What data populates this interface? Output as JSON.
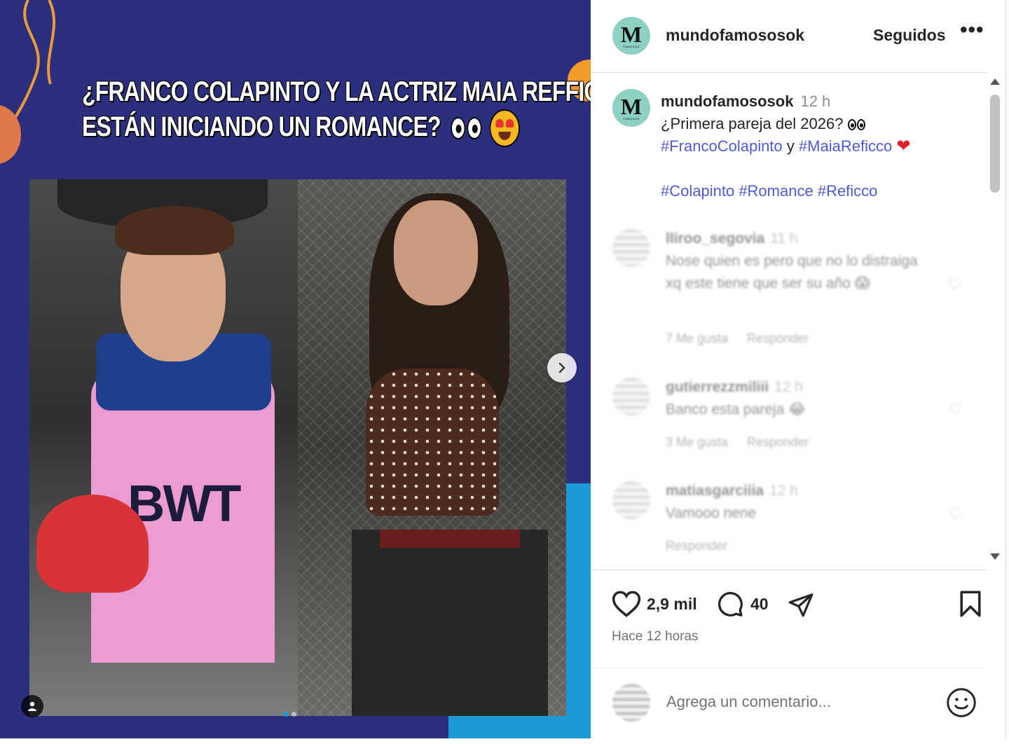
{
  "post": {
    "headline_line1": "¿FRANCO COLAPINTO Y LA ACTRIZ MAIA REFFICO",
    "headline_line2": "ESTÁN INICIANDO UN ROMANCE?",
    "photo_logo_text": "BWT"
  },
  "header": {
    "avatar_letter": "M",
    "avatar_sub": "FAMOSOS",
    "username": "mundofamososok",
    "follow_label": "Seguidos",
    "more_label": "•••"
  },
  "caption": {
    "username": "mundofamososok",
    "time": "12 h",
    "text1": "¿Primera pareja del 2026?",
    "hashtag1": "#FrancoColapinto",
    "connector": "y",
    "hashtag2": "#MaiaReficco",
    "heart": "❤",
    "hashtag3": "#Colapinto",
    "hashtag4": "#Romance",
    "hashtag5": "#Reficco"
  },
  "comments": [
    {
      "user": "lliroo_segovia",
      "time": "11 h",
      "text": "Nose quien es pero que no lo distraiga xq este tiene que ser su año 😱",
      "likes": "7 Me gusta",
      "reply": "Responder"
    },
    {
      "user": "gutierrezzmiliii",
      "time": "12 h",
      "text": "Banco esta pareja 😂",
      "likes": "3 Me gusta",
      "reply": "Responder"
    },
    {
      "user": "matiasgarciiia",
      "time": "12 h",
      "text": "Vamooo nene",
      "likes": "",
      "reply": "Responder"
    }
  ],
  "actions": {
    "likes": "2,9 mil",
    "comments": "40",
    "time_ago": "Hace 12 horas"
  },
  "add_comment": {
    "placeholder": "Agrega un comentario..."
  },
  "colors": {
    "media_bg": "#2b2f7e",
    "hashtag": "#4f5bd5",
    "accent_orange": "#f39a2a",
    "accent_blue": "#1c9ad6"
  },
  "carousel": {
    "current": 1,
    "total": 2
  }
}
